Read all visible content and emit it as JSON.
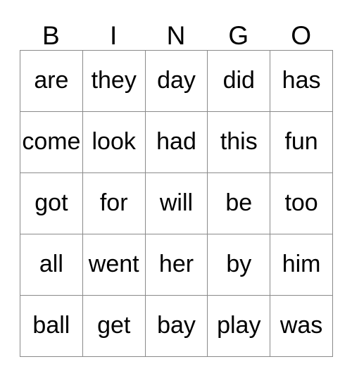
{
  "card": {
    "title": "BINGO",
    "headers": [
      "B",
      "I",
      "N",
      "G",
      "O"
    ],
    "colors": {
      "grid_border": "#8a8a8a",
      "cell_background": "#ffffff",
      "text": "#000000",
      "page_background": "#ffffff"
    },
    "rows": [
      {
        "cells": [
          "are",
          "they",
          "day",
          "did",
          "has"
        ]
      },
      {
        "cells": [
          "come",
          "look",
          "had",
          "this",
          "fun"
        ]
      },
      {
        "cells": [
          "got",
          "for",
          "will",
          "be",
          "too"
        ]
      },
      {
        "cells": [
          "all",
          "went",
          "her",
          "by",
          "him"
        ]
      },
      {
        "cells": [
          "ball",
          "get",
          "bay",
          "play",
          "was"
        ]
      }
    ]
  }
}
